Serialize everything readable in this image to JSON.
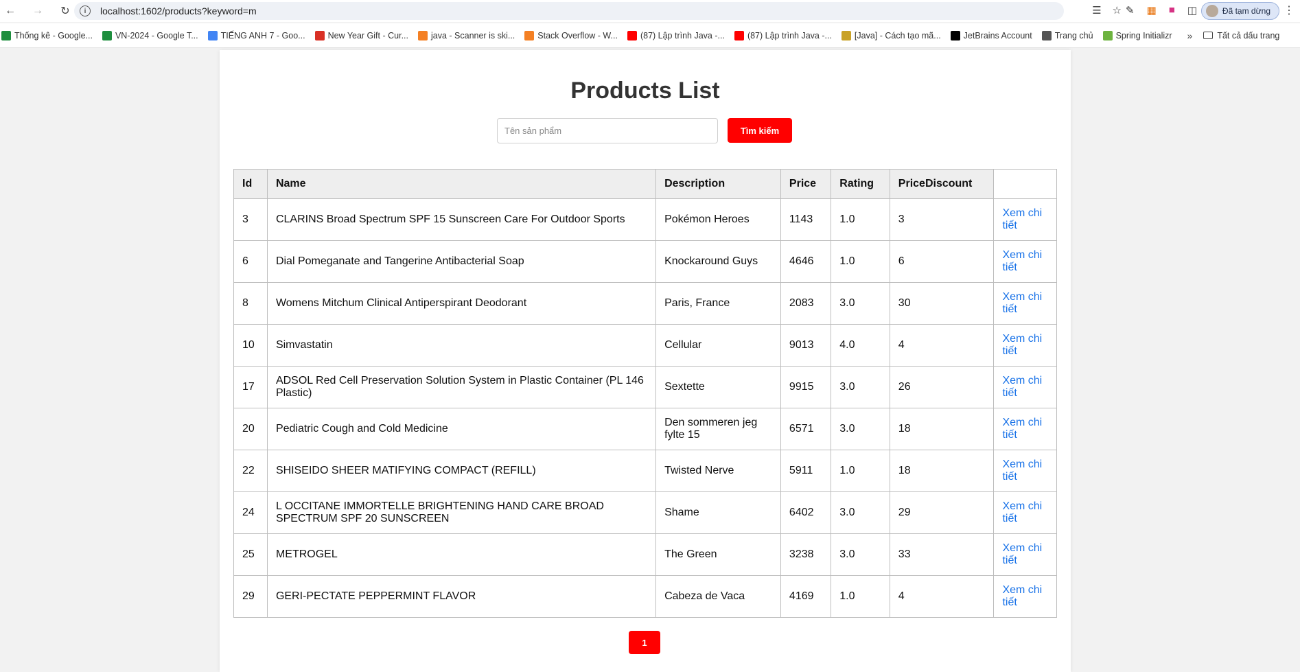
{
  "browser": {
    "url": "localhost:1602/products?keyword=m",
    "profile_label": "Đã tạm dừng",
    "bookmarks": [
      {
        "label": "Thống kê - Google...",
        "color": "#1e8e3e"
      },
      {
        "label": "VN-2024 - Google T...",
        "color": "#1e8e3e"
      },
      {
        "label": "TIẾNG ANH 7 - Goo...",
        "color": "#4285f4"
      },
      {
        "label": "New Year Gift - Cur...",
        "color": "#d93025"
      },
      {
        "label": "java - Scanner is ski...",
        "color": "#f48024"
      },
      {
        "label": "Stack Overflow - W...",
        "color": "#f48024"
      },
      {
        "label": "(87) Lập trình Java -...",
        "color": "#ff0000"
      },
      {
        "label": "(87) Lập trình Java -...",
        "color": "#ff0000"
      },
      {
        "label": "[Java] - Cách tạo mã...",
        "color": "#c9a227"
      },
      {
        "label": "JetBrains Account",
        "color": "#000000"
      },
      {
        "label": "Trang chủ",
        "color": "#555555"
      },
      {
        "label": "Spring Initializr",
        "color": "#6db33f"
      }
    ],
    "all_bookmarks_label": "Tất cả dấu trang"
  },
  "page": {
    "title": "Products List",
    "search_placeholder": "Tên sản phẩm",
    "search_button": "Tìm kiếm",
    "columns": [
      "Id",
      "Name",
      "Description",
      "Price",
      "Rating",
      "PriceDiscount",
      ""
    ],
    "rows": [
      {
        "id": "3",
        "name": "CLARINS Broad Spectrum SPF 15 Sunscreen Care For Outdoor Sports",
        "description": "Pokémon Heroes",
        "price": "1143",
        "rating": "1.0",
        "discount": "3",
        "action": "Xem chi tiết"
      },
      {
        "id": "6",
        "name": "Dial Pomeganate and Tangerine Antibacterial Soap",
        "description": "Knockaround Guys",
        "price": "4646",
        "rating": "1.0",
        "discount": "6",
        "action": "Xem chi tiết"
      },
      {
        "id": "8",
        "name": "Womens Mitchum Clinical Antiperspirant Deodorant",
        "description": "Paris, France",
        "price": "2083",
        "rating": "3.0",
        "discount": "30",
        "action": "Xem chi tiết"
      },
      {
        "id": "10",
        "name": "Simvastatin",
        "description": "Cellular",
        "price": "9013",
        "rating": "4.0",
        "discount": "4",
        "action": "Xem chi tiết"
      },
      {
        "id": "17",
        "name": "ADSOL Red Cell Preservation Solution System in Plastic Container (PL 146 Plastic)",
        "description": "Sextette",
        "price": "9915",
        "rating": "3.0",
        "discount": "26",
        "action": "Xem chi tiết"
      },
      {
        "id": "20",
        "name": "Pediatric Cough and Cold Medicine",
        "description": "Den sommeren jeg fylte 15",
        "price": "6571",
        "rating": "3.0",
        "discount": "18",
        "action": "Xem chi tiết"
      },
      {
        "id": "22",
        "name": "SHISEIDO SHEER MATIFYING COMPACT (REFILL)",
        "description": "Twisted Nerve",
        "price": "5911",
        "rating": "1.0",
        "discount": "18",
        "action": "Xem chi tiết"
      },
      {
        "id": "24",
        "name": "L OCCITANE IMMORTELLE BRIGHTENING HAND CARE BROAD SPECTRUM SPF 20 SUNSCREEN",
        "description": "Shame",
        "price": "6402",
        "rating": "3.0",
        "discount": "29",
        "action": "Xem chi tiết"
      },
      {
        "id": "25",
        "name": "METROGEL",
        "description": "The Green",
        "price": "3238",
        "rating": "3.0",
        "discount": "33",
        "action": "Xem chi tiết"
      },
      {
        "id": "29",
        "name": "GERI-PECTATE PEPPERMINT FLAVOR",
        "description": "Cabeza de Vaca",
        "price": "4169",
        "rating": "1.0",
        "discount": "4",
        "action": "Xem chi tiết"
      }
    ],
    "pagination": [
      "1"
    ],
    "accent_color": "#ff0000",
    "link_color": "#1a73e8"
  }
}
